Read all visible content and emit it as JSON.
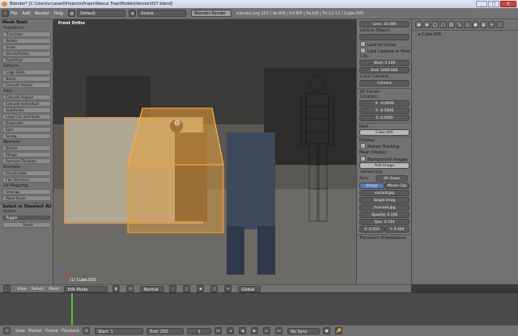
{
  "window": {
    "title": "Blender* [C:\\Users\\crussell\\Projects\\ProjectNexus Trap\\Models\\Version007.blend]",
    "buttons": [
      "_",
      "□",
      "X"
    ]
  },
  "header": {
    "menus": [
      "File",
      "Add",
      "Render",
      "Help"
    ],
    "layout": "Default",
    "scene": "Scene",
    "engine": "Blender Render",
    "info": "blender.org 263 | Ve:8/8 | Ed:8/8 | Fa:6/8 | Tri:12-12 | Cube.005"
  },
  "toolshelf": {
    "title": "Mesh Tools",
    "sections": [
      {
        "label": "Transform:",
        "buttons": [
          "Translate",
          "Rotate",
          "Scale",
          "Shrink/Fatten",
          "Push/Pull"
        ]
      },
      {
        "label": "Deform:",
        "buttons": [
          "Edge Slide",
          "Noise",
          "Smooth Vertex"
        ]
      },
      {
        "label": "Add:",
        "buttons": [
          "Extrude Region",
          "Extrude Individual",
          "Subdivide",
          "Loop Cut and Slide",
          "Duplicate",
          "Spin",
          "Screw"
        ]
      },
      {
        "label": "Remove:",
        "buttons": [
          "Delete",
          "Merge",
          "Remove Doubles"
        ]
      },
      {
        "label": "Normals:",
        "buttons": [
          "Recalculate",
          "Flip Direction"
        ]
      },
      {
        "label": "UV Mapping:",
        "buttons": [
          "Unwrap",
          "Mark Seam"
        ]
      }
    ],
    "operator_header": "Select or Deselect All",
    "action_label": "Action",
    "action_value": "Toggle",
    "reset": "Reset"
  },
  "viewport": {
    "label": "Front Ortho",
    "object_label": "(1) Cube.005"
  },
  "npanel": {
    "lens": "Lens: 35.000",
    "lock_to_object": "Lock to Object:",
    "lock_cursor": "Lock to Cursor",
    "lock_camera": "Lock Camera to View",
    "clip_label": "Clip:",
    "clip_start": "Start: 0.100",
    "clip_end": "End: 1000.000",
    "local_camera_label": "Local Camera:",
    "local_camera": "Camera",
    "cursor_header": "3D Cursor",
    "location_label": "Location:",
    "loc_x": "X: -0.0000",
    "loc_y": "Y: -0.5900",
    "loc_z": "Z: 0.0400",
    "item_header": "Item",
    "item_name": "Cube.005",
    "display": "Display",
    "motion_tracking": "Motion Tracking",
    "mesh_display": "Mesh Display",
    "bg_images": "Background Images",
    "add_image": "Add Image",
    "image_name": "variant.jpg",
    "axis_label": "Axis:",
    "axis_value": "All Views",
    "tab_image": "Image",
    "tab_clip": "Movie Clip",
    "img_file": "variant.jpg",
    "source": "Single Imag",
    "path": "//variant.jpg",
    "opacity": "Opacity: 0.500",
    "size": "Size: 0.740",
    "offset_x": "X: 0.050",
    "offset_y": "Y: 0.050",
    "transform_orientations": "Transform Orientations"
  },
  "right": {
    "breadcrumb": "Cube.005"
  },
  "vpfooter": {
    "items": [
      "View",
      "Select",
      "Mesh"
    ],
    "mode": "Edit Mode",
    "shading": "Normal",
    "pivot": "Global"
  },
  "bottombar": {
    "items": [
      "View",
      "Marker",
      "Frame",
      "Playback"
    ],
    "start": "Start: 1",
    "end": "End: 250",
    "current": "1",
    "sync": "No Sync"
  }
}
